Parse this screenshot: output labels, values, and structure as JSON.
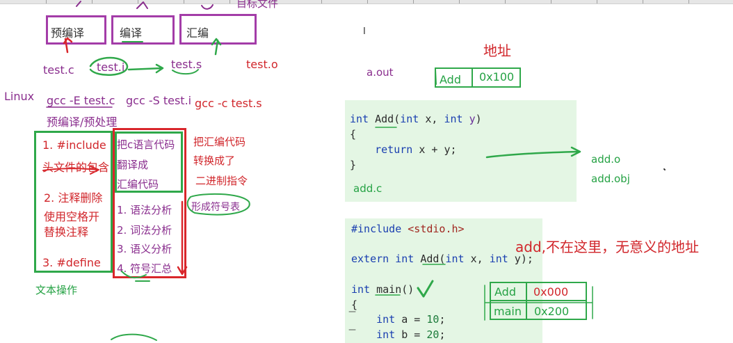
{
  "top": {
    "cut_text": "目标文件"
  },
  "stages": {
    "precompile": "预编译",
    "compile": "编译",
    "assemble": "汇编"
  },
  "files": {
    "test_c": "test.c",
    "test_i": "test.i",
    "test_s": "test.s",
    "test_o": "test.o"
  },
  "os": "Linux",
  "commands": {
    "cmd1": "gcc -E test.c",
    "cmd2": "gcc -S test.i",
    "cmd3": "gcc -c test.s",
    "cmd1_note": "预编译/预处理"
  },
  "box1": {
    "l1": "1. #include",
    "l2": "头文件的包含",
    "l3": "2. 注释删除",
    "l4": "使用空格开",
    "l5": "替换注释",
    "l6": "3. #define"
  },
  "box1_caption": "文本操作",
  "box2": {
    "l1": "把c语言代码",
    "l2": "翻译成",
    "l3": "汇编代码",
    "a1": "1. 语法分析",
    "a2": "2. 词法分析",
    "a3": "3. 语义分析",
    "a4": "4. 符号汇总"
  },
  "box3": {
    "l1": "把汇编代码",
    "l2": "转换成了",
    "l3": "二进制指令"
  },
  "symbol_note": "形成符号表",
  "right": {
    "cursor": "I",
    "address_title": "地址",
    "aout": "a.out",
    "addr_table_top": {
      "name": "Add",
      "addr": "0x100"
    },
    "code1": {
      "lines": [
        {
          "parts": [
            [
              "kw",
              "int"
            ],
            [
              "fn",
              " Add("
            ],
            [
              "kw",
              "int"
            ],
            [
              "fn",
              " x, "
            ],
            [
              "kw",
              "int"
            ],
            [
              "pm",
              " y"
            ],
            [
              "fn",
              ")"
            ]
          ]
        },
        {
          "parts": [
            [
              "fn",
              "{"
            ]
          ]
        },
        {
          "parts": [
            [
              "fn",
              "    "
            ],
            [
              "kw",
              "return"
            ],
            [
              "fn",
              " x + y;"
            ]
          ]
        },
        {
          "parts": [
            [
              "fn",
              "}"
            ]
          ]
        }
      ],
      "label": "add.c"
    },
    "outputs": {
      "o": "add.o",
      "obj": "add.obj"
    },
    "code2": {
      "lines": [
        {
          "parts": [
            [
              "kw",
              "#include"
            ],
            [
              "str",
              " <stdio.h>"
            ]
          ]
        },
        {
          "parts": [
            [
              "fn",
              ""
            ]
          ]
        },
        {
          "parts": [
            [
              "kw",
              "extern"
            ],
            [
              "kw",
              " int"
            ],
            [
              "fn",
              " Add("
            ],
            [
              "kw",
              "int"
            ],
            [
              "fn",
              " x, "
            ],
            [
              "kw",
              "int"
            ],
            [
              "fn",
              " y);"
            ]
          ]
        },
        {
          "parts": [
            [
              "fn",
              ""
            ]
          ]
        },
        {
          "parts": [
            [
              "kw",
              "int"
            ],
            [
              "fn",
              " main()"
            ]
          ]
        },
        {
          "parts": [
            [
              "fn",
              "{"
            ]
          ]
        },
        {
          "parts": [
            [
              "fn",
              "    "
            ],
            [
              "kw",
              "int"
            ],
            [
              "fn",
              " a = "
            ],
            [
              "num",
              "10"
            ],
            [
              "fn",
              ";"
            ]
          ]
        },
        {
          "parts": [
            [
              "fn",
              "    "
            ],
            [
              "kw",
              "int"
            ],
            [
              "fn",
              " b = "
            ],
            [
              "num",
              "20"
            ],
            [
              "fn",
              ";"
            ]
          ]
        }
      ]
    },
    "warning": "add,不在这里，无意义的地址",
    "addr_table_bottom": [
      {
        "name": "Add",
        "addr": "0x000"
      },
      {
        "name": "main",
        "addr": "0x200"
      }
    ]
  },
  "colors": {
    "purple": "#8a2e8e",
    "red": "#d1262b",
    "green": "#25a244",
    "code_bg": "#e4f6e4"
  }
}
